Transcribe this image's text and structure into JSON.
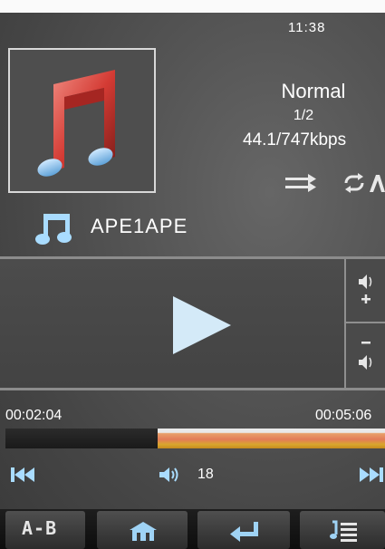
{
  "status_bar": {
    "time": "11:38"
  },
  "playback": {
    "mode": "Normal",
    "track_index": "1/2",
    "bitrate": "44.1/747kbps",
    "track_title": "APE1APE",
    "elapsed": "00:02:04",
    "total": "00:05:06",
    "progress": 0.4
  },
  "volume": {
    "level": "18"
  },
  "bottom_tabs": {
    "ab_repeat_label": "A-B"
  },
  "icons": {
    "album_art": "music-note-album-icon",
    "shuffle": "shuffle-icon",
    "repeat": "repeat-all-icon",
    "note": "music-note-icon",
    "play": "play-icon",
    "volume_up": "volume-up-icon",
    "volume_down": "volume-down-icon",
    "previous": "previous-track-icon",
    "next": "next-track-icon",
    "speaker": "speaker-icon",
    "home": "home-icon",
    "back": "return-icon",
    "playlist": "playlist-icon"
  },
  "colors": {
    "background": "#4a4a4a",
    "progress_played": "#1a1a1a",
    "progress_remaining": "#e37c58",
    "accent_blue": "#9fd3f5"
  }
}
